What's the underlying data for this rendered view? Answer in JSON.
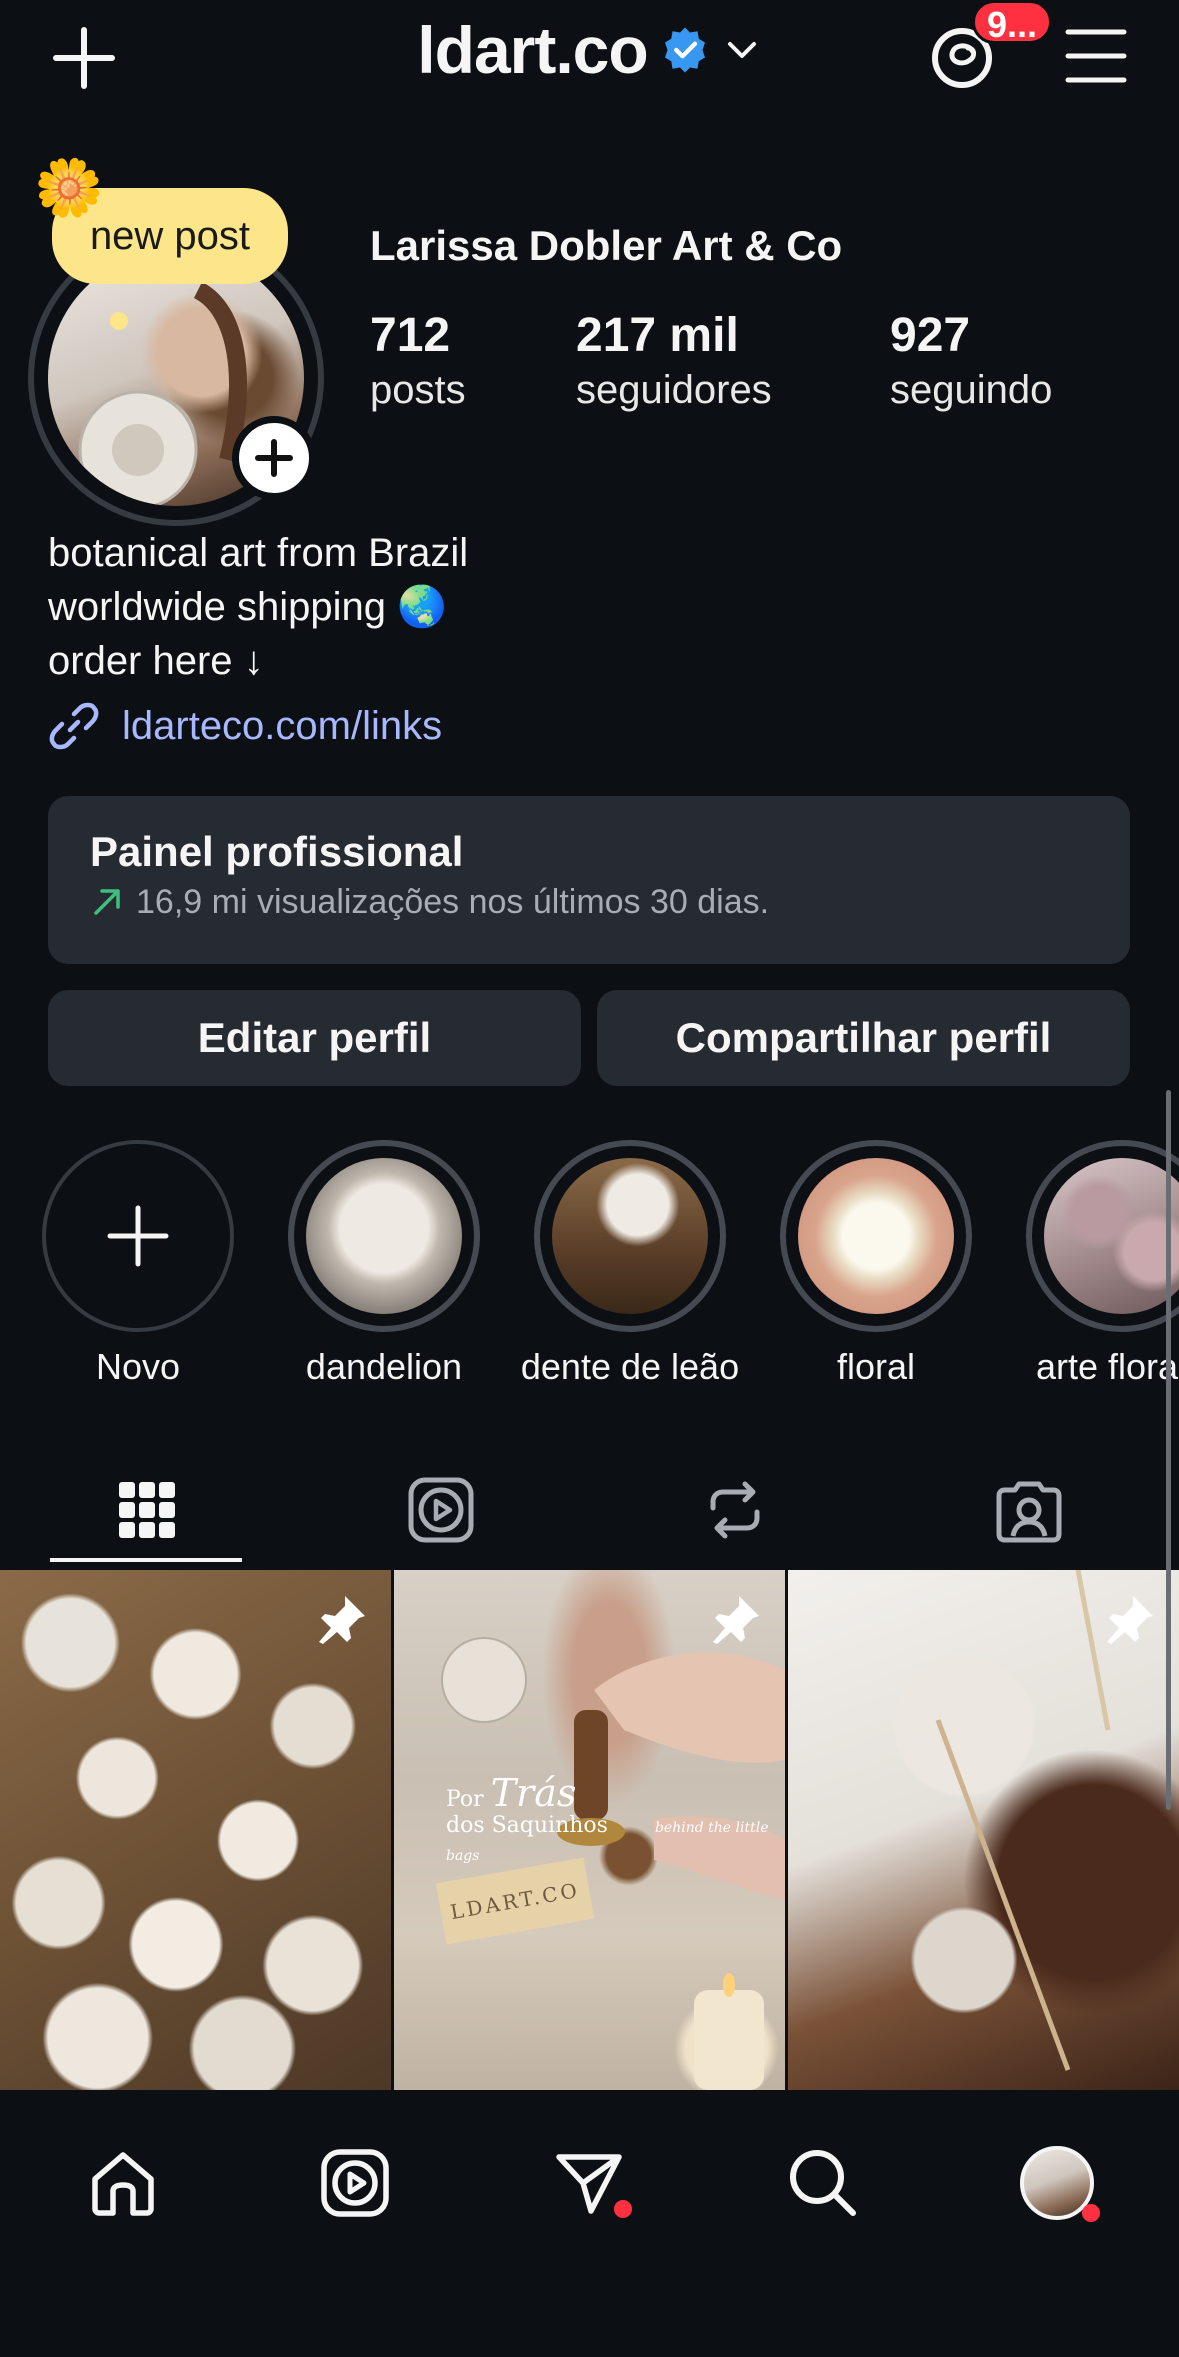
{
  "header": {
    "username": "ldart.co",
    "verified_icon": "verified-badge-icon",
    "dropdown_icon": "chevron-down-icon",
    "create_icon": "plus-icon",
    "threads_icon": "threads-icon",
    "threads_badge": "9...",
    "menu_icon": "hamburger-menu-icon"
  },
  "profile": {
    "note": "new post",
    "note_emoji": "🌼",
    "display_name": "Larissa Dobler Art & Co",
    "stats": [
      {
        "value": "712",
        "label": "posts"
      },
      {
        "value": "217 mil",
        "label": "seguidores"
      },
      {
        "value": "927",
        "label": "seguindo"
      }
    ],
    "bio_lines": [
      "botanical art from Brazil",
      "worldwide shipping 🌏",
      "order here ↓"
    ],
    "link": "ldarteco.com/links"
  },
  "professional_panel": {
    "title": "Painel profissional",
    "subtitle": "16,9 mi visualizações nos últimos 30 dias."
  },
  "actions": {
    "edit": "Editar perfil",
    "share": "Compartilhar perfil"
  },
  "highlights": [
    {
      "label": "Novo"
    },
    {
      "label": "dandelion"
    },
    {
      "label": "dente de leão"
    },
    {
      "label": "floral"
    },
    {
      "label": "arte floral"
    }
  ],
  "tabs": [
    "grid-icon",
    "reels-icon",
    "reposts-icon",
    "tagged-icon"
  ],
  "posts": [
    {
      "pinned": true
    },
    {
      "pinned": true,
      "overlay_title_1": "Por",
      "overlay_title_2": "Trás",
      "overlay_title_3": "dos Saquinhos",
      "overlay_caption": "behind the little bags",
      "overlay_logo": "LDART.CO"
    },
    {
      "pinned": true
    }
  ],
  "bottom_nav": [
    "home-icon",
    "reels-icon",
    "messages-icon",
    "search-icon",
    "profile-avatar"
  ],
  "colors": {
    "background": "#0c1014",
    "surface": "#262a31",
    "accent_link": "#a8b8ff",
    "notification_red": "#ff3040",
    "verified_blue": "#3897f0",
    "note_yellow": "#fde68a"
  }
}
